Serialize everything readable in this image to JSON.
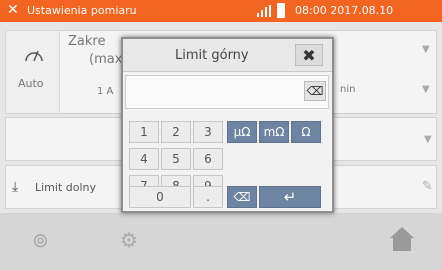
{
  "status": {
    "title": "Ustawienia pomiaru",
    "datetime": "08:00 2017.08.10"
  },
  "bg": {
    "auto_label": "Auto",
    "range_title_1": "Zakre",
    "range_title_2": "(max",
    "range_value": "1 A",
    "right_partial": "nin",
    "limit_lower": "Limit dolny"
  },
  "dialog": {
    "title": "Limit górny",
    "keys": {
      "k1": "1",
      "k2": "2",
      "k3": "3",
      "k4": "4",
      "k5": "5",
      "k6": "6",
      "k7": "7",
      "k8": "8",
      "k9": "9",
      "k0": "0",
      "dot": ".",
      "u1": "μΩ",
      "u2": "mΩ",
      "u3": "Ω",
      "back": "⌫",
      "enter": "↵"
    }
  },
  "colors": {
    "status_bar": "#f2641f",
    "unit_key": "#6e85a1"
  }
}
